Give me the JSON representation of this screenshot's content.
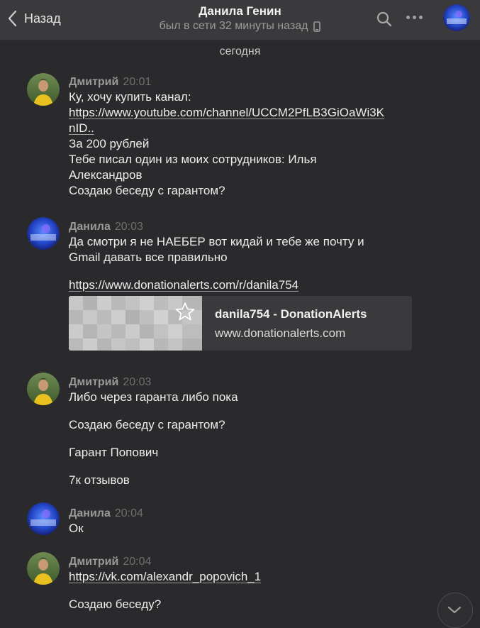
{
  "header": {
    "back_label": "Назад",
    "title": "Данила Генин",
    "subtitle": "был в сети 32 минуты назад",
    "icons": {
      "back": "chevron-left-icon",
      "search": "search-icon",
      "more": "more-dots-icon",
      "device": "mobile-phone-icon"
    }
  },
  "day_separator": "сегодня",
  "messages": [
    {
      "author": "Дмитрий",
      "time": "20:01",
      "lines": [
        "Ку, хочу купить канал:",
        "https://www.youtube.com/channel/UCCM2PfLB3GiOaWi3K",
        "nID..",
        "За 200 рублей",
        "Тебе писал один из моих сотрудников: Илья",
        "Александров",
        "Создаю беседу с гарантом?"
      ]
    },
    {
      "author": "Данила",
      "time": "20:03",
      "lines": [
        "Да смотри я не НАЕБЕР вот кидай и тебе же почту и",
        "Gmail давать все правильно",
        "https://www.donationalerts.com/r/danila754"
      ],
      "card": {
        "title": "danila754 - DonationAlerts",
        "domain": "www.donationalerts.com",
        "icon": "star-icon"
      }
    },
    {
      "author": "Дмитрий",
      "time": "20:03",
      "lines": [
        "Либо через гаранта либо пока",
        "Создаю беседу с гарантом?",
        "Гарант Попович",
        "7к отзывов"
      ]
    },
    {
      "author": "Данила",
      "time": "20:04",
      "lines": [
        "Ок"
      ]
    },
    {
      "author": "Дмитрий",
      "time": "20:04",
      "lines": [
        "https://vk.com/alexandr_popovich_1",
        "Создаю беседу?"
      ]
    }
  ],
  "scroll_down_icon": "chevron-down-icon",
  "colors": {
    "background": "#2a2a2c",
    "header": "#3a3a3c",
    "text": "#ededed",
    "muted": "#9a9a9a"
  }
}
